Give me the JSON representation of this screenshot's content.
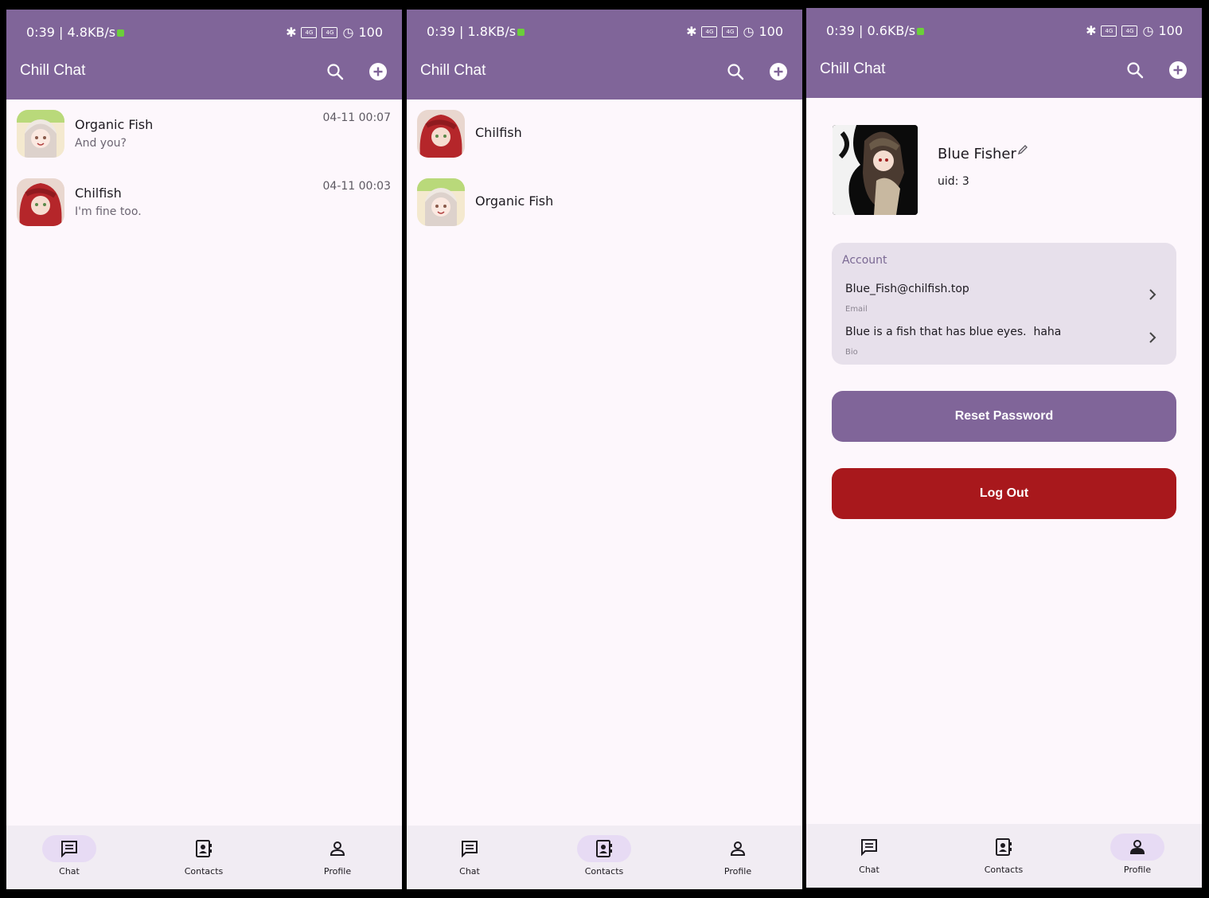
{
  "app": {
    "title": "Chill Chat"
  },
  "colors": {
    "primary": "#806599",
    "danger": "#a8181c",
    "background": "#fdf7fc",
    "card": "#e7e0eb"
  },
  "screens": [
    {
      "status": {
        "time_speed": "0:39 | 4.8KB/s",
        "battery": "100"
      },
      "chats": [
        {
          "name": "Organic Fish",
          "last_message": "And you?",
          "time": "04-11 00:07",
          "avatar": "girl-icon"
        },
        {
          "name": "Chilfish",
          "last_message": "I'm fine too.",
          "time": "04-11 00:03",
          "avatar": "redhead-icon"
        }
      ]
    },
    {
      "status": {
        "time_speed": "0:39 | 1.8KB/s",
        "battery": "100"
      },
      "contacts": [
        {
          "name": "Chilfish",
          "avatar": "redhead-icon"
        },
        {
          "name": "Organic Fish",
          "avatar": "girl-icon"
        }
      ]
    },
    {
      "status": {
        "time_speed": "0:39 | 0.6KB/s",
        "battery": "100"
      },
      "profile": {
        "name": "Blue Fisher",
        "uid": "uid: 3",
        "account_title": "Account",
        "email": "Blue_Fish@chilfish.top",
        "email_label": "Email",
        "bio": "Blue is a fish that has blue eyes.  haha",
        "bio_label": "Bio",
        "reset_label": "Reset Password",
        "logout_label": "Log Out"
      }
    }
  ],
  "nav": {
    "chat": "Chat",
    "contacts": "Contacts",
    "profile": "Profile"
  }
}
